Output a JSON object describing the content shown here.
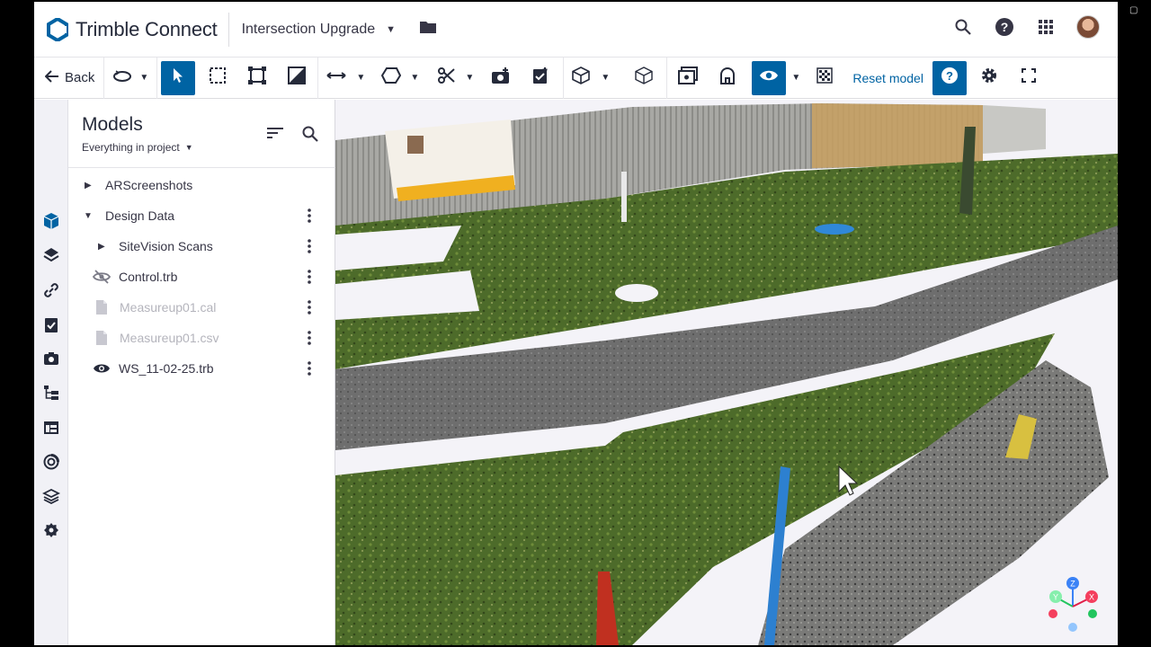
{
  "app": {
    "brand": "Trimble Connect",
    "project": "Intersection Upgrade"
  },
  "colors": {
    "accent": "#0063a3",
    "brand_blue": "#0063a3",
    "text": "#252a3a",
    "rail_bg": "#f1f1f6"
  },
  "header": {
    "icons": [
      "search-icon",
      "help-icon",
      "apps-grid-icon",
      "user-avatar"
    ]
  },
  "toolbar": {
    "back_label": "Back",
    "reset_label": "Reset model",
    "tools": [
      "orbit",
      "select",
      "box-select",
      "fit-view",
      "section",
      "measure",
      "markup-shape",
      "clip",
      "snapshot",
      "todo",
      "view-cube",
      "object-box",
      "ghost-view",
      "ar-view",
      "visibility",
      "render-mode",
      "reset-model",
      "help",
      "settings",
      "fullscreen"
    ],
    "active_tools": [
      "select",
      "visibility",
      "help"
    ]
  },
  "rail": {
    "icons": [
      "models-icon",
      "layers-icon",
      "link-icon",
      "todo-icon",
      "camera-icon",
      "tree-icon",
      "table-icon",
      "view-icon",
      "stack-icon",
      "badge-icon"
    ],
    "active": "models-icon"
  },
  "panel": {
    "title": "Models",
    "scope": "Everything in project",
    "items": [
      {
        "label": "ARScreenshots",
        "expanded": false,
        "type": "folder",
        "has_menu": false,
        "dim": false
      },
      {
        "label": "Design Data",
        "expanded": true,
        "type": "folder",
        "has_menu": true,
        "dim": false
      },
      {
        "label": "SiteVision Scans",
        "expanded": false,
        "type": "folder",
        "has_menu": true,
        "dim": false
      },
      {
        "label": "Control.trb",
        "type": "file",
        "icon": "eye-hidden-icon",
        "has_menu": true,
        "dim": false
      },
      {
        "label": "Measureup01.cal",
        "type": "file",
        "icon": "file-icon",
        "has_menu": true,
        "dim": true
      },
      {
        "label": "Measureup01.csv",
        "type": "file",
        "icon": "file-icon",
        "has_menu": true,
        "dim": true
      },
      {
        "label": "WS_11-02-25.trb",
        "type": "file",
        "icon": "eye-icon",
        "has_menu": true,
        "dim": false
      }
    ]
  },
  "viewport": {
    "content": "point-cloud-scan",
    "gizmo_axes": [
      "Z",
      "Y",
      "X"
    ]
  }
}
